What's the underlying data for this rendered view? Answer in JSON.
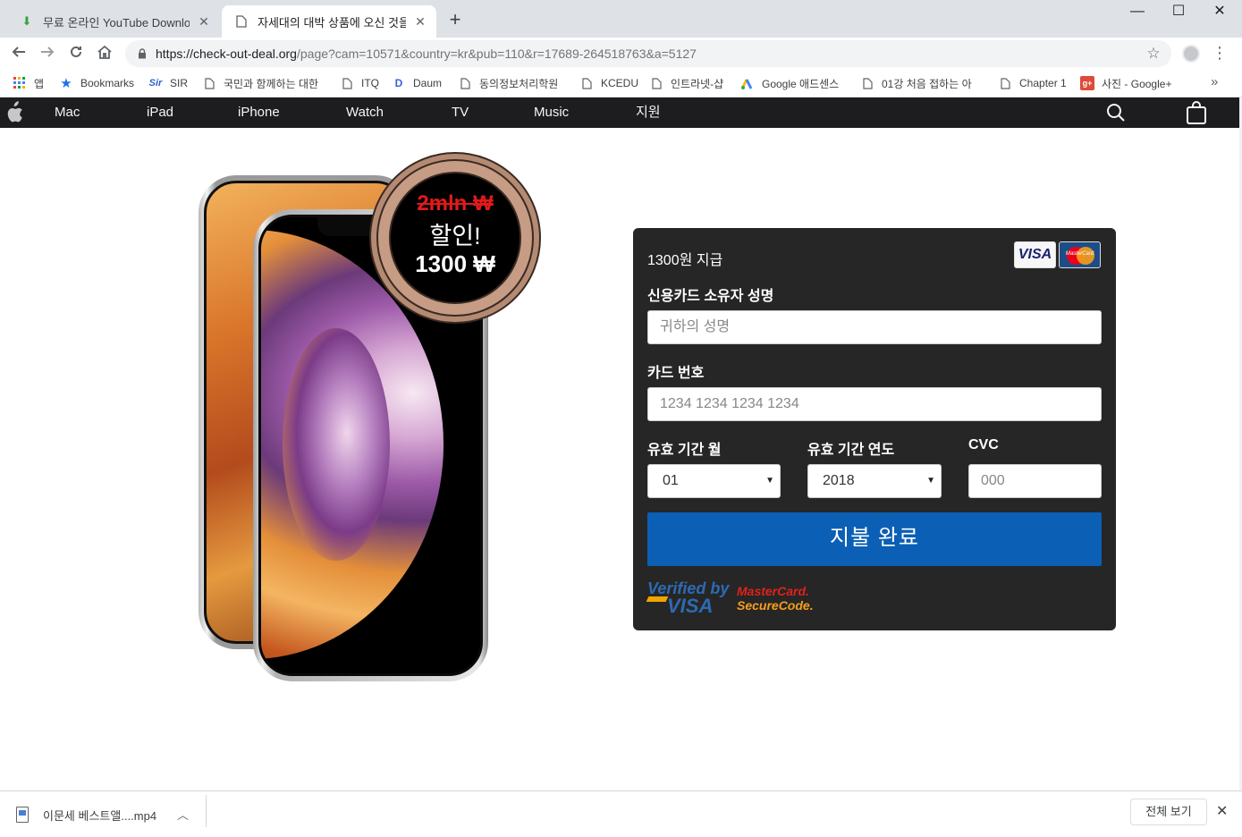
{
  "browser": {
    "tabs": [
      {
        "title": "무료 온라인 YouTube Download",
        "icon": "download-arrow-icon",
        "active": false
      },
      {
        "title": "자세대의 대박 상품에 오신 것을",
        "icon": "page-icon",
        "active": true
      }
    ],
    "new_tab": "+",
    "window_controls": {
      "minimize": "—",
      "maximize": "☐",
      "close": "✕"
    },
    "url_host": "https://check-out-deal.org",
    "url_path": "/page?cam=10571&country=kr&pub=110&r=17689-264518763&a=5127",
    "bookmarks": [
      {
        "label": "앱",
        "icon": "apps-grid-icon"
      },
      {
        "label": "Bookmarks",
        "icon": "star-icon"
      },
      {
        "label": "SIR",
        "icon": "sir-logo-icon"
      },
      {
        "label": "국민과 함께하는 대한",
        "icon": "page-icon"
      },
      {
        "label": "ITQ",
        "icon": "page-icon"
      },
      {
        "label": "Daum",
        "icon": "daum-logo-icon"
      },
      {
        "label": "동의정보처리학원",
        "icon": "page-icon"
      },
      {
        "label": "KCEDU",
        "icon": "page-icon"
      },
      {
        "label": "인트라넷-샵",
        "icon": "page-icon"
      },
      {
        "label": "Google 애드센스",
        "icon": "adsense-logo-icon"
      },
      {
        "label": "01강 처음 접하는 아",
        "icon": "page-icon"
      },
      {
        "label": "Chapter 1",
        "icon": "page-icon"
      },
      {
        "label": "사진 - Google+",
        "icon": "google-plus-icon"
      }
    ],
    "bookmarks_more": "»"
  },
  "site_nav": {
    "items": [
      "Mac",
      "iPad",
      "iPhone",
      "Watch",
      "TV",
      "Music",
      "지원"
    ]
  },
  "badge": {
    "old_price": "2mln ₩",
    "sale": "할인!",
    "price": "1300 ₩"
  },
  "payment": {
    "amount_text": "1300원 지급",
    "card_logos": {
      "visa": "VISA",
      "mastercard": "MasterCard"
    },
    "name_label": "신용카드 소유자 성명",
    "name_placeholder": "귀하의 성명",
    "card_label": "카드 번호",
    "card_placeholder": "1234 1234 1234 1234",
    "month_label": "유효 기간 월",
    "month_value": "01",
    "year_label": "유효 기간 연도",
    "year_value": "2018",
    "cvc_label": "CVC",
    "cvc_placeholder": "000",
    "submit_label": "지불 완료",
    "verified_visa_line1": "Verified by",
    "verified_visa_line2": "VISA",
    "mc_secure_line1": "MasterCard.",
    "mc_secure_line2": "SecureCode."
  },
  "downloads": {
    "file_name": "이문세 베스트앨....mp4",
    "show_all": "전체 보기",
    "close": "✕"
  },
  "colors": {
    "nav_bg": "#1d1d1f",
    "panel_bg": "#262626",
    "submit_bg": "#0b5fb5",
    "old_price": "#e01a1a"
  }
}
